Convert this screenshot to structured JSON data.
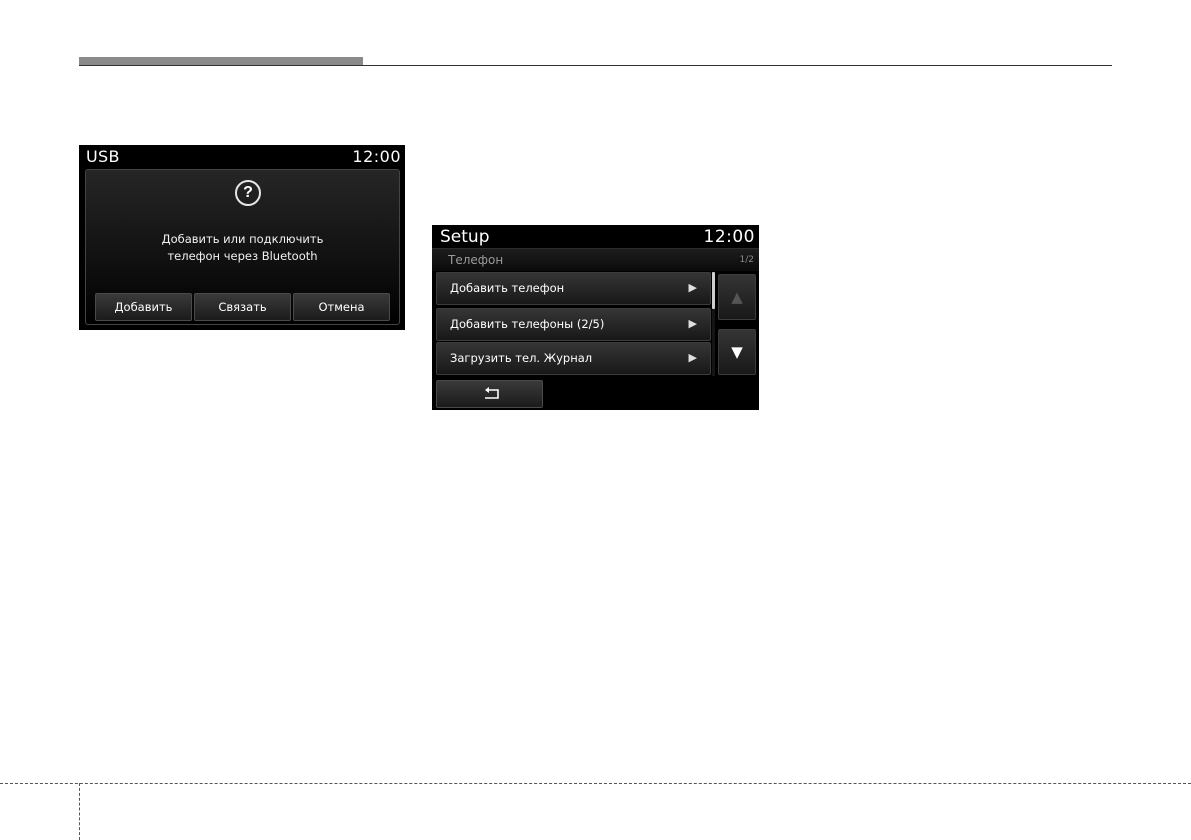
{
  "usb_screen": {
    "title": "USB",
    "time": "12:00",
    "dialog": {
      "icon": "question-icon",
      "icon_glyph": "?",
      "message_line1": "Добавить или подключить",
      "message_line2": "телефон через Bluetooth",
      "buttons": [
        "Добавить",
        "Связать",
        "Отмена"
      ]
    }
  },
  "setup_screen": {
    "title": "Setup",
    "time": "12:00",
    "section": "Телефон",
    "page": "1/2",
    "menu_items": [
      {
        "label": "Добавить телефон",
        "arrow": "▶"
      },
      {
        "label": "Добавить телефоны (2/5)",
        "arrow": "▶"
      },
      {
        "label": "Загрузить тел. Журнал",
        "arrow": "▶"
      }
    ],
    "scroll_up_glyph": "▲",
    "scroll_down_glyph": "▼",
    "scroll_up_enabled": false,
    "back_icon": "back-arrow-icon"
  },
  "colors": {
    "screen_bg": "#000000",
    "text": "#ffffff",
    "disabled": "#555555"
  }
}
